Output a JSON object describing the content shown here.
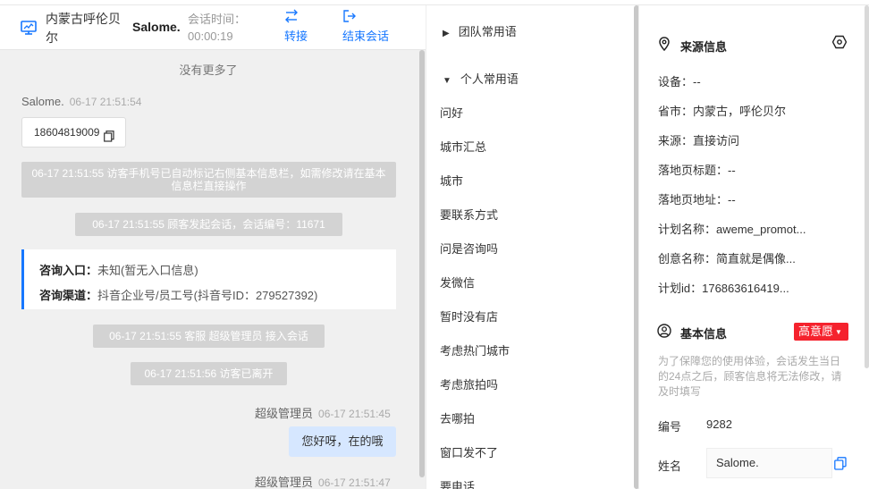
{
  "header": {
    "location": "内蒙古呼伦贝尔",
    "visitor_name": "Salome.",
    "session_time_label": "会话时间：",
    "session_time_value": "00:00:19",
    "transfer_label": "转接",
    "end_label": "结束会话"
  },
  "chat": {
    "no_more": "没有更多了",
    "visitor_msg": {
      "sender": "Salome.",
      "time": "06-17 21:51:54",
      "text": "18604819009"
    },
    "sys_phone_tag": "06-17 21:51:55 访客手机号已自动标记右侧基本信息栏，如需修改请在基本信息栏直接操作",
    "sys_session_start": "06-17 21:51:55 顾客发起会话，会话编号：11671",
    "consult_card": {
      "entry_label": "咨询入口：",
      "entry_value": "未知(暂无入口信息)",
      "channel_label": "咨询渠道：",
      "channel_value": "抖音企业号/员工号(抖音号ID：279527392)"
    },
    "sys_agent_join": "06-17 21:51:55 客服 超级管理员 接入会话",
    "sys_visitor_left": "06-17 21:51:56 访客已离开",
    "agent_msg1": {
      "sender": "超级管理员",
      "time": "06-17 21:51:45",
      "text": "您好呀，在的哦"
    },
    "agent_msg2": {
      "sender": "超级管理员",
      "time": "06-17 21:51:47"
    }
  },
  "phrases": {
    "team_group": "团队常用语",
    "personal_group": "个人常用语",
    "items": [
      "问好",
      "城市汇总",
      "城市",
      "要联系方式",
      "问是咨询吗",
      "发微信",
      "暂时没有店",
      "考虑热门城市",
      "考虑旅拍吗",
      "去哪拍",
      "窗口发不了",
      "要电话"
    ]
  },
  "source_info": {
    "title": "来源信息",
    "device": "设备：--",
    "province": "省市：内蒙古，呼伦贝尔",
    "source": "来源：直接访问",
    "landing_title": "落地页标题：--",
    "landing_url": "落地页地址：--",
    "plan_name": "计划名称：aweme_promot...",
    "creative_name": "创意名称：简直就是偶像...",
    "plan_id": "计划id：176863616419..."
  },
  "basic_info": {
    "title": "基本信息",
    "intent_tag": "高意愿",
    "note": "为了保障您的使用体验，会话发生当日的24点之后，顾客信息将无法修改，请及时填写",
    "id_label": "编号",
    "id_value": "9282",
    "name_label": "姓名",
    "name_value": "Salome."
  },
  "colors": {
    "accent": "#1677ff",
    "tag_red": "#f5222d",
    "system_gray": "#d3d3d3",
    "agent_bubble": "#d6e7ff"
  }
}
